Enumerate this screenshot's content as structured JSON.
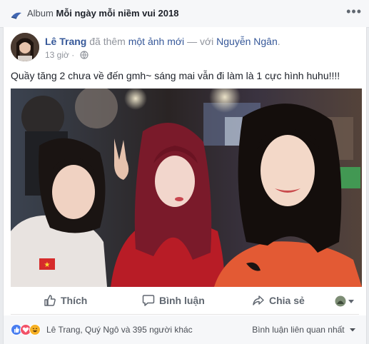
{
  "album": {
    "prefix": "Album",
    "name": "Mỗi ngày mỗi niềm vui 2018",
    "more_icon": "more-horizontal-icon"
  },
  "post": {
    "author": "Lê Trang",
    "action_text": "đã thêm",
    "link_text": "một ảnh mới",
    "with_text": "— với",
    "tagged": "Nguyễn Ngân",
    "time": "13 giờ",
    "separator": "·",
    "privacy_icon": "globe-icon",
    "text": "Quầy tăng 2 chưa về đến gmh~ sáng mai vẫn đi làm là 1 cực hình huhu!!!!"
  },
  "actions": {
    "like": "Thích",
    "comment": "Bình luận",
    "share": "Chia sẻ"
  },
  "reactions": {
    "summary": "Lê Trang, Quý Ngô và 395 người khác",
    "sort_label": "Bình luận liên quan nhất",
    "types": [
      "like",
      "love",
      "haha"
    ],
    "colors": {
      "like": "#4a7ef0",
      "love": "#f25268",
      "haha": "#f7b125",
      "link": "#365899"
    }
  }
}
